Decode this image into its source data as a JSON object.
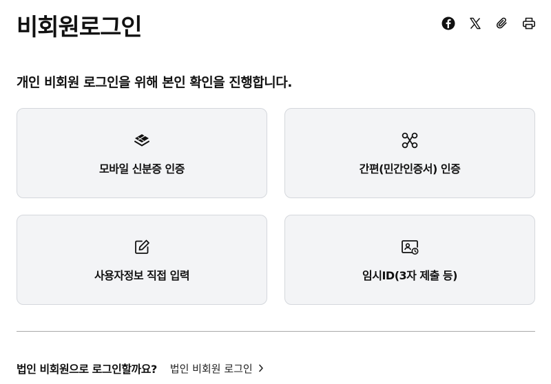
{
  "page": {
    "title": "비회원로그인",
    "subtitle": "개인 비회원 로그인을 위해 본인 확인을 진행합니다."
  },
  "share_bar": {
    "icons": [
      "facebook-icon",
      "x-icon",
      "paperclip-icon",
      "printer-icon"
    ]
  },
  "cards": [
    {
      "label": "모바일 신분증 인증",
      "icon": "stacked-layers-icon"
    },
    {
      "label": "간편(민간인증서) 인증",
      "icon": "connected-nodes-icon"
    },
    {
      "label": "사용자정보 직접 입력",
      "icon": "edit-pencil-icon"
    },
    {
      "label": "임시ID(3자 제출 등)",
      "icon": "id-card-clock-icon"
    }
  ],
  "footer": {
    "question": "법인 비회원으로 로그인할까요?",
    "link_label": "법인 비회원 로그인"
  },
  "colors": {
    "card_bg": "#f3f4f6",
    "card_border": "#d4d7dc",
    "text": "#111111",
    "divider": "#a8a8a8"
  }
}
